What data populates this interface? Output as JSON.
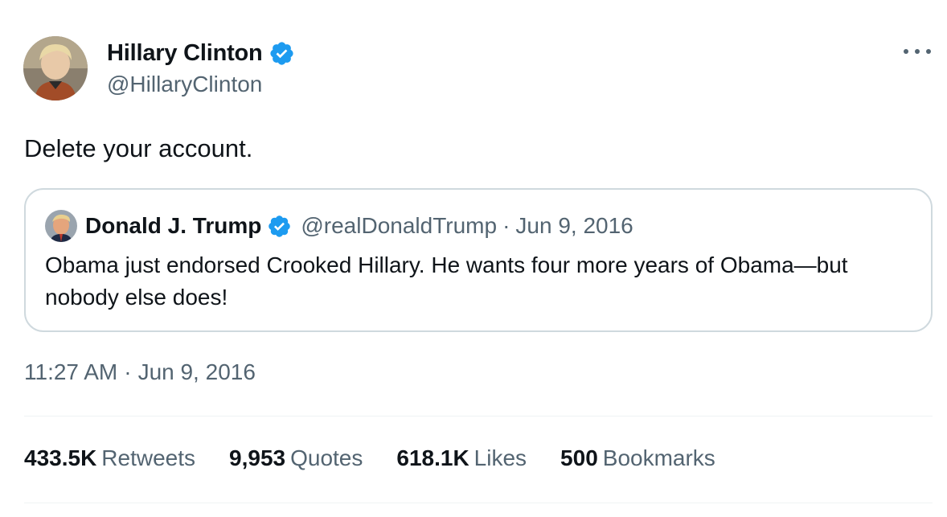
{
  "author": {
    "display_name": "Hillary Clinton",
    "handle": "@HillaryClinton",
    "verified": true
  },
  "tweet": {
    "text": "Delete your account.",
    "timestamp_time": "11:27 AM",
    "timestamp_sep": "·",
    "timestamp_date": "Jun 9, 2016"
  },
  "quoted": {
    "display_name": "Donald J. Trump",
    "handle": "@realDonaldTrump",
    "sep": "·",
    "date": "Jun 9, 2016",
    "text": "Obama just endorsed Crooked Hillary. He wants four more years of Obama—but nobody else does!",
    "verified": true
  },
  "stats": [
    {
      "value": "433.5K",
      "label": "Retweets"
    },
    {
      "value": "9,953",
      "label": "Quotes"
    },
    {
      "value": "618.1K",
      "label": "Likes"
    },
    {
      "value": "500",
      "label": "Bookmarks"
    }
  ],
  "colors": {
    "verified_blue": "#1d9bf0",
    "text_primary": "#0f1419",
    "text_secondary": "#536471",
    "border": "#cfd9de"
  },
  "icons": {
    "verified": "verified-badge-icon",
    "more": "more-horizontal-icon"
  }
}
